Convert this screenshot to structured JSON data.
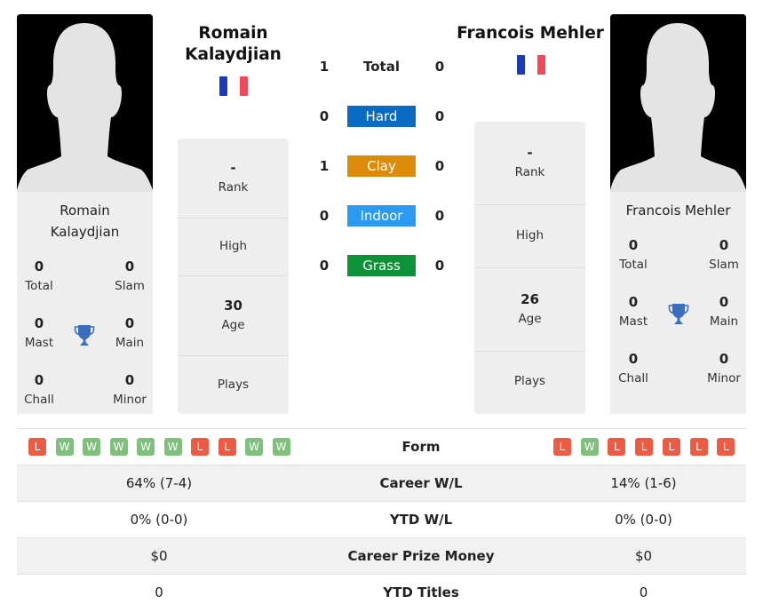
{
  "colors": {
    "hard": "#0b6bc3",
    "clay": "#dc8c0a",
    "indoor": "#2b9bf1",
    "grass": "#0e9237",
    "win": "#7ec07c",
    "loss": "#ee5b45",
    "trophy": "#3a6fbf"
  },
  "player1": {
    "name": "Romain Kalaydjian",
    "name_line1": "Romain",
    "name_line2": "Kalaydjian",
    "flag": "france-flag",
    "card": {
      "name_line1": "Romain",
      "name_line2": "Kalaydjian",
      "stats": [
        {
          "value": "0",
          "label": "Total"
        },
        {
          "value": "0",
          "label": "Slam"
        },
        {
          "value": "0",
          "label": "Mast"
        },
        {
          "value": "0",
          "label": "Main"
        },
        {
          "value": "0",
          "label": "Chall"
        },
        {
          "value": "0",
          "label": "Minor"
        }
      ]
    },
    "info": {
      "rank_value": "-",
      "rank_label": "Rank",
      "high_label": "High",
      "age_value": "30",
      "age_label": "Age",
      "plays_label": "Plays"
    }
  },
  "player2": {
    "name": "Francois Mehler",
    "flag": "france-flag",
    "card": {
      "name": "Francois Mehler",
      "stats": [
        {
          "value": "0",
          "label": "Total"
        },
        {
          "value": "0",
          "label": "Slam"
        },
        {
          "value": "0",
          "label": "Mast"
        },
        {
          "value": "0",
          "label": "Main"
        },
        {
          "value": "0",
          "label": "Chall"
        },
        {
          "value": "0",
          "label": "Minor"
        }
      ]
    },
    "info": {
      "rank_value": "-",
      "rank_label": "Rank",
      "high_label": "High",
      "age_value": "26",
      "age_label": "Age",
      "plays_label": "Plays"
    }
  },
  "h2h": [
    {
      "label": "Total",
      "left": "1",
      "right": "0"
    },
    {
      "label": "Hard",
      "left": "0",
      "right": "0"
    },
    {
      "label": "Clay",
      "left": "1",
      "right": "0"
    },
    {
      "label": "Indoor",
      "left": "0",
      "right": "0"
    },
    {
      "label": "Grass",
      "left": "0",
      "right": "0"
    }
  ],
  "comparison": {
    "form": {
      "label": "Form",
      "left": [
        "L",
        "W",
        "W",
        "W",
        "W",
        "W",
        "L",
        "L",
        "W",
        "W"
      ],
      "right": [
        "L",
        "W",
        "L",
        "L",
        "L",
        "L",
        "L"
      ]
    },
    "rows": [
      {
        "label": "Career W/L",
        "left": "64% (7-4)",
        "right": "14% (1-6)"
      },
      {
        "label": "YTD W/L",
        "left": "0% (0-0)",
        "right": "0% (0-0)"
      },
      {
        "label": "Career Prize Money",
        "left": "$0",
        "right": "$0"
      },
      {
        "label": "YTD Titles",
        "left": "0",
        "right": "0"
      }
    ]
  }
}
